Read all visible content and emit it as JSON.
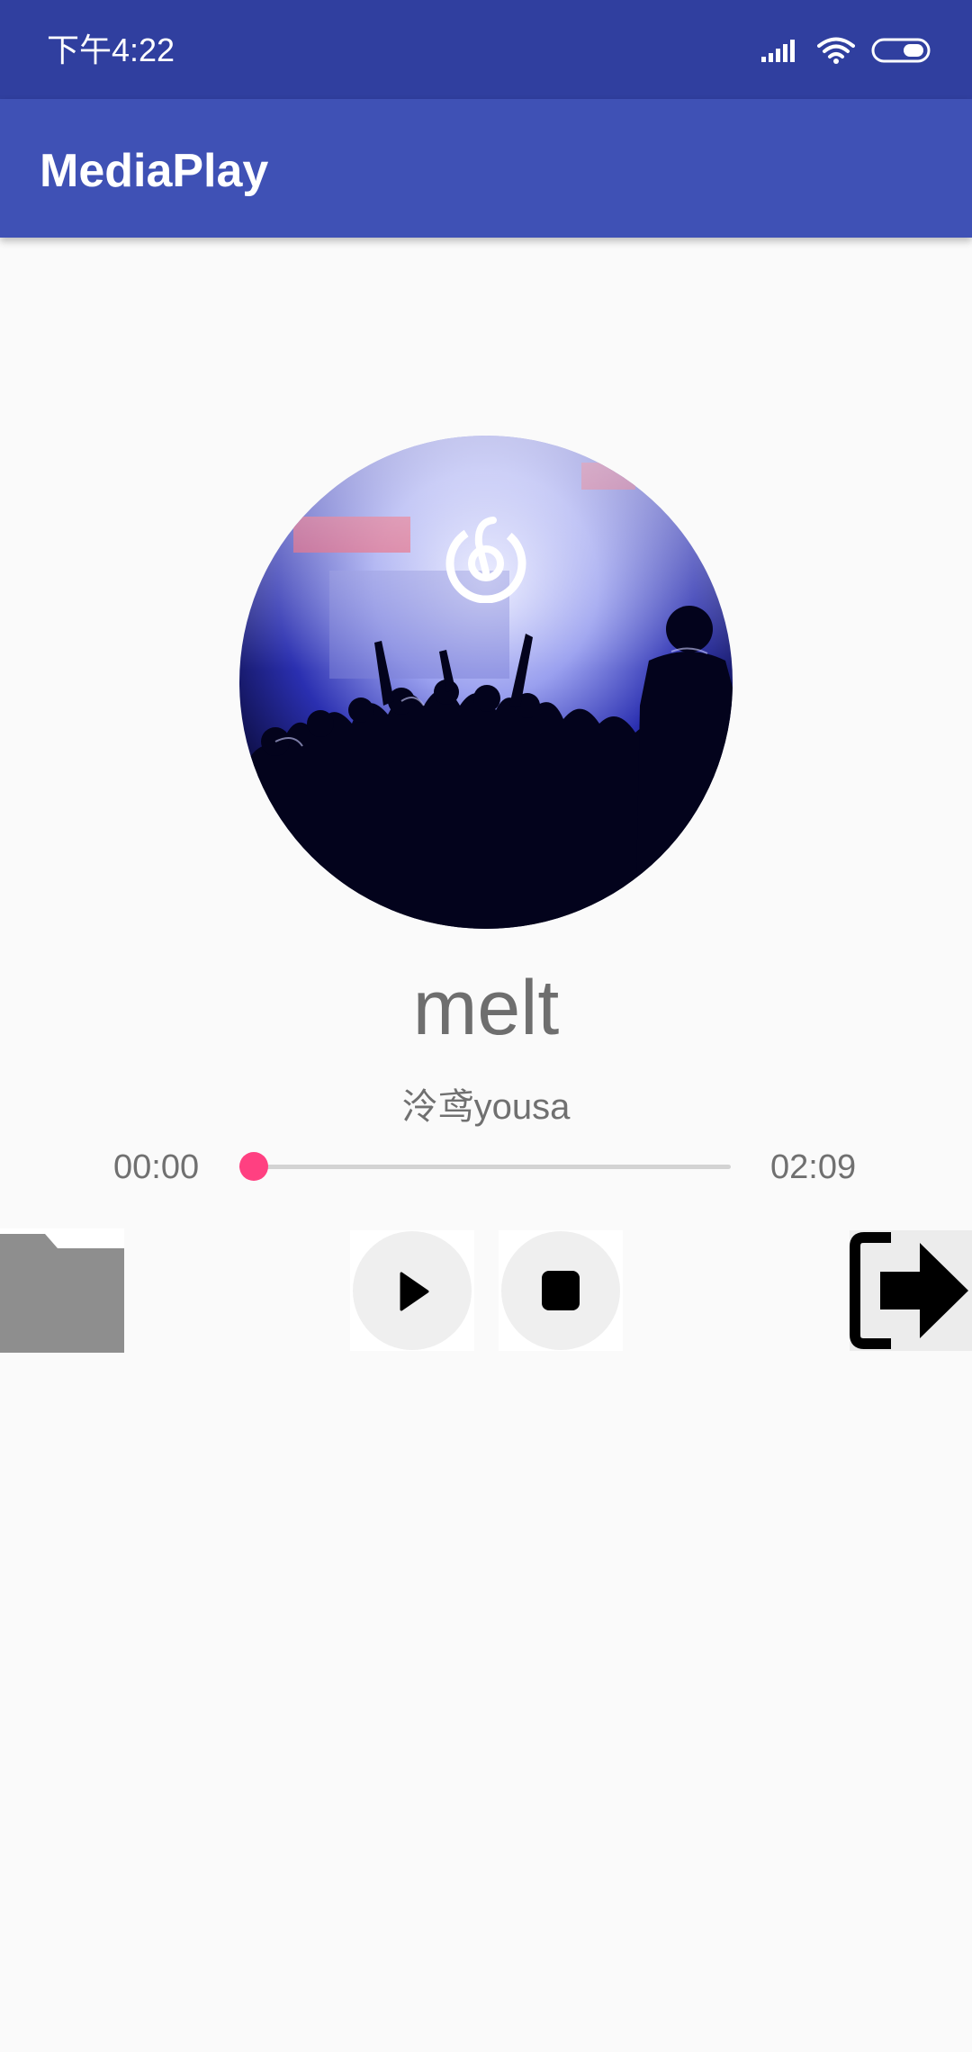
{
  "status_bar": {
    "time": "下午4:22",
    "icons": [
      "signal-icon",
      "wifi-icon",
      "battery-icon"
    ],
    "background": "#303f9f"
  },
  "app_bar": {
    "title": "MediaPlay",
    "background": "#3f51b5"
  },
  "album": {
    "art": "concert-crowd-artwork",
    "logo_icon": "netease-music-logo-icon"
  },
  "song": {
    "title": "melt",
    "artist": "泠鸢yousa"
  },
  "progress": {
    "current": "00:00",
    "total": "02:09",
    "fraction": 0.0,
    "accent": "#ff4081"
  },
  "controls": {
    "folder_icon": "folder-icon",
    "play_icon": "play-icon",
    "stop_icon": "stop-icon",
    "exit_icon": "exit-icon"
  }
}
